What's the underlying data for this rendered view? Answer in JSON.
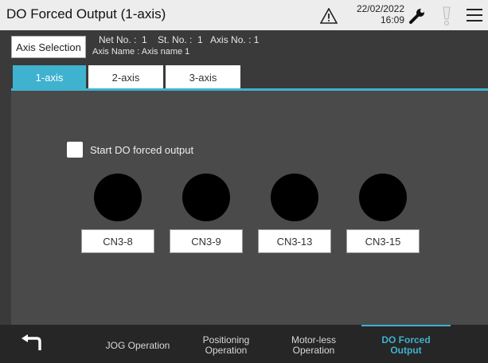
{
  "header": {
    "title": "DO Forced Output (1-axis)",
    "date": "22/02/2022",
    "time": "16:09"
  },
  "info": {
    "axis_selection_label": "Axis Selection",
    "line1": "Net No. :  1    St. No. :  1   Axis No. : 1",
    "line2": "Axis Name : Axis name 1"
  },
  "tabs": [
    {
      "label": "1-axis",
      "active": true
    },
    {
      "label": "2-axis",
      "active": false
    },
    {
      "label": "3-axis",
      "active": false
    }
  ],
  "main": {
    "start_label": "Start DO forced output",
    "start_checked": false,
    "outputs": [
      {
        "label": "CN3-8"
      },
      {
        "label": "CN3-9"
      },
      {
        "label": "CN3-13"
      },
      {
        "label": "CN3-15"
      }
    ]
  },
  "footer": {
    "nav": [
      {
        "line1": "JOG Operation",
        "line2": ""
      },
      {
        "line1": "Positioning",
        "line2": "Operation"
      },
      {
        "line1": "Motor-less",
        "line2": "Operation"
      },
      {
        "line1": "DO Forced",
        "line2": "Output"
      }
    ]
  },
  "colors": {
    "accent": "#3fb2cf",
    "background": "#3a3a3a",
    "lamp_off": "#000000"
  },
  "icons": [
    "warning-icon",
    "wrench-icon",
    "alarm-icon",
    "menu-icon",
    "back-icon"
  ]
}
